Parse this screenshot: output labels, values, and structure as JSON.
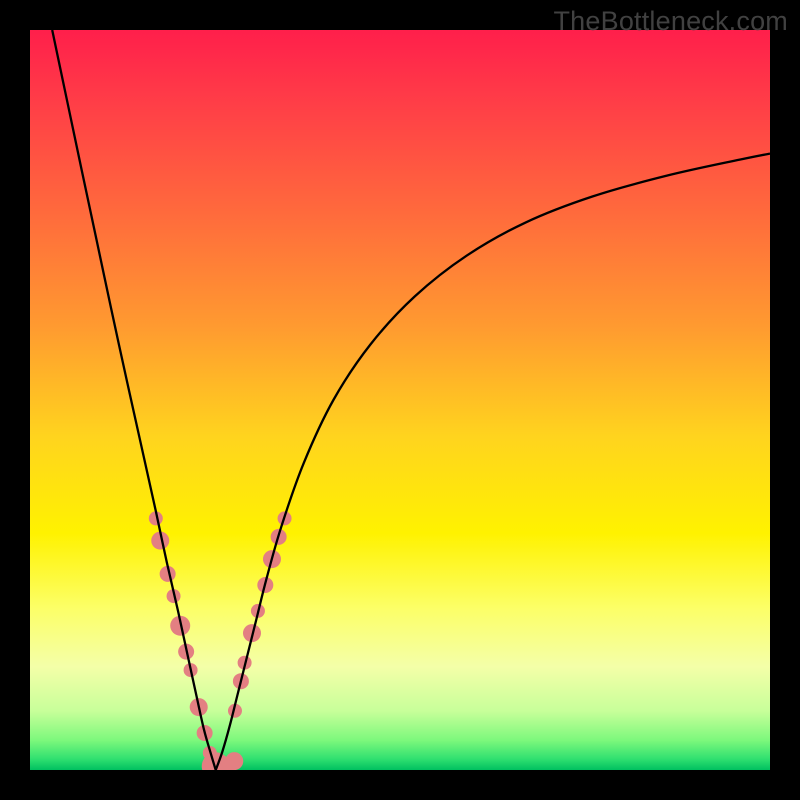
{
  "watermark": {
    "text": "TheBottleneck.com"
  },
  "chart_data": {
    "type": "line",
    "title": "",
    "xlabel": "",
    "ylabel": "",
    "xlim": [
      0,
      100
    ],
    "ylim": [
      0,
      100
    ],
    "grid": false,
    "legend": false,
    "background_gradient_stops": [
      {
        "offset": 0.0,
        "color": "#ff1f4b"
      },
      {
        "offset": 0.1,
        "color": "#ff3e47"
      },
      {
        "offset": 0.25,
        "color": "#ff6b3c"
      },
      {
        "offset": 0.4,
        "color": "#ff9a30"
      },
      {
        "offset": 0.55,
        "color": "#ffd41e"
      },
      {
        "offset": 0.68,
        "color": "#fff200"
      },
      {
        "offset": 0.78,
        "color": "#fcff66"
      },
      {
        "offset": 0.86,
        "color": "#f4ffa8"
      },
      {
        "offset": 0.92,
        "color": "#c8ff9a"
      },
      {
        "offset": 0.96,
        "color": "#7cf87c"
      },
      {
        "offset": 0.985,
        "color": "#30e070"
      },
      {
        "offset": 1.0,
        "color": "#00c060"
      }
    ],
    "series": [
      {
        "name": "left-branch",
        "stroke": "#000000",
        "width": 2.3,
        "x": [
          3.0,
          5.0,
          7.0,
          9.0,
          11.0,
          13.0,
          15.0,
          17.0,
          18.5,
          20.0,
          21.3,
          22.5,
          23.5,
          24.5,
          25.1
        ],
        "y": [
          100,
          90.5,
          81.0,
          71.6,
          62.2,
          53.0,
          44.0,
          35.0,
          28.0,
          21.5,
          15.5,
          10.0,
          5.5,
          2.0,
          0.0
        ]
      },
      {
        "name": "right-branch",
        "stroke": "#000000",
        "width": 2.3,
        "x": [
          25.1,
          26.0,
          27.0,
          28.0,
          29.0,
          30.5,
          32.0,
          34.0,
          37.0,
          41.0,
          46.0,
          52.0,
          59.0,
          67.0,
          76.0,
          86.0,
          96.0,
          100.0
        ],
        "y": [
          0.0,
          2.5,
          6.0,
          10.0,
          14.0,
          20.0,
          26.0,
          33.0,
          41.5,
          50.0,
          57.5,
          64.0,
          69.5,
          74.0,
          77.5,
          80.3,
          82.5,
          83.3
        ]
      },
      {
        "name": "pink-markers",
        "marker_color": "#e37f82",
        "marker_radius_range": [
          5,
          18
        ],
        "points": [
          {
            "x": 17.0,
            "y": 34.0,
            "r": 7
          },
          {
            "x": 17.6,
            "y": 31.0,
            "r": 9
          },
          {
            "x": 18.6,
            "y": 26.5,
            "r": 8
          },
          {
            "x": 19.4,
            "y": 23.5,
            "r": 7
          },
          {
            "x": 20.3,
            "y": 19.5,
            "r": 10
          },
          {
            "x": 21.1,
            "y": 16.0,
            "r": 8
          },
          {
            "x": 21.7,
            "y": 13.5,
            "r": 7
          },
          {
            "x": 22.8,
            "y": 8.5,
            "r": 9
          },
          {
            "x": 23.6,
            "y": 5.0,
            "r": 8
          },
          {
            "x": 24.3,
            "y": 2.3,
            "r": 7
          },
          {
            "x": 25.1,
            "y": 0.5,
            "r": 14
          },
          {
            "x": 26.2,
            "y": 0.5,
            "r": 10
          },
          {
            "x": 27.6,
            "y": 1.2,
            "r": 9
          },
          {
            "x": 27.7,
            "y": 8.0,
            "r": 7
          },
          {
            "x": 28.5,
            "y": 12.0,
            "r": 8
          },
          {
            "x": 29.0,
            "y": 14.5,
            "r": 7
          },
          {
            "x": 30.0,
            "y": 18.5,
            "r": 9
          },
          {
            "x": 30.8,
            "y": 21.5,
            "r": 7
          },
          {
            "x": 31.8,
            "y": 25.0,
            "r": 8
          },
          {
            "x": 32.7,
            "y": 28.5,
            "r": 9
          },
          {
            "x": 33.6,
            "y": 31.5,
            "r": 8
          },
          {
            "x": 34.4,
            "y": 34.0,
            "r": 7
          }
        ]
      }
    ]
  }
}
